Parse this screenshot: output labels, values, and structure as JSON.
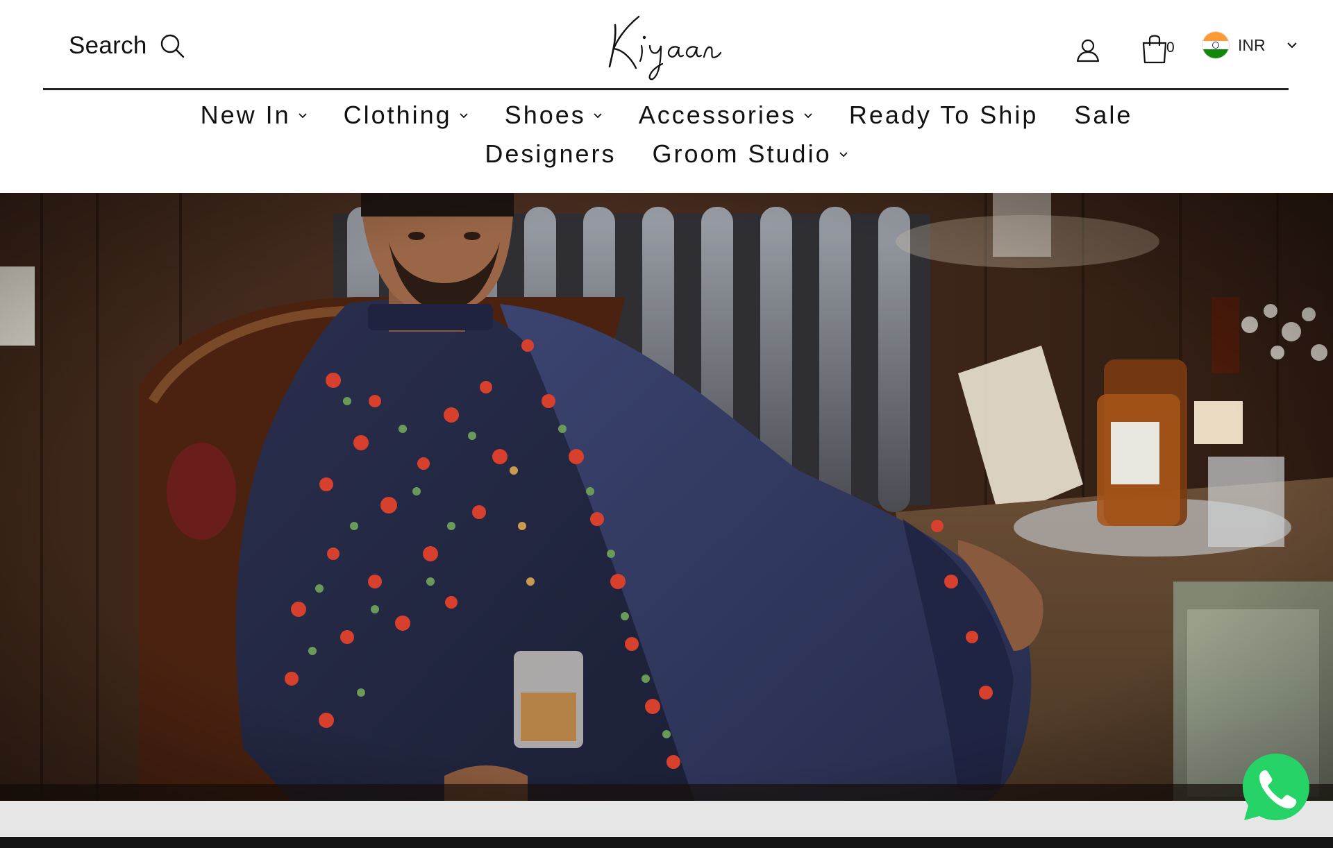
{
  "header": {
    "search_label": "Search",
    "logo_text": "Kiyaan",
    "cart_count": "0",
    "currency": {
      "code": "INR",
      "flag": "india-flag-icon"
    }
  },
  "nav": {
    "items": [
      {
        "label": "New In",
        "has_dropdown": true
      },
      {
        "label": "Clothing",
        "has_dropdown": true
      },
      {
        "label": "Shoes",
        "has_dropdown": true
      },
      {
        "label": "Accessories",
        "has_dropdown": true
      },
      {
        "label": "Ready To Ship",
        "has_dropdown": false
      },
      {
        "label": "Sale",
        "has_dropdown": false
      },
      {
        "label": "Designers",
        "has_dropdown": false
      },
      {
        "label": "Groom Studio",
        "has_dropdown": true
      }
    ]
  },
  "icons": {
    "search": "search-icon",
    "account": "user-icon",
    "cart": "shopping-bag-icon",
    "dropdown": "chevron-down-icon",
    "chat": "whatsapp-icon"
  },
  "colors": {
    "header_background": "#ffffff",
    "text": "#111111",
    "rule": "#222222",
    "whatsapp_green": "#25d366",
    "footer_strip": "#151515"
  }
}
